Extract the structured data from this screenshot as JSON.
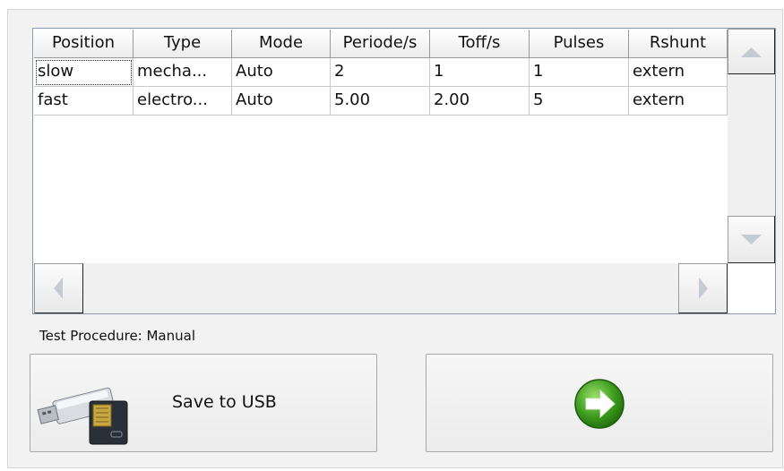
{
  "table": {
    "columns": [
      "Position",
      "Type",
      "Mode",
      "Periode/s",
      "Toff/s",
      "Pulses",
      "Rshunt"
    ],
    "rows": [
      [
        "slow",
        "mecha...",
        "Auto",
        "2",
        "1",
        "1",
        "extern"
      ],
      [
        "fast",
        "electro...",
        "Auto",
        "5.00",
        "2.00",
        "5",
        "extern"
      ]
    ]
  },
  "scrollbars": {
    "up_icon": "arrow-up-icon",
    "down_icon": "arrow-down-icon",
    "left_icon": "arrow-left-icon",
    "right_icon": "arrow-right-icon"
  },
  "procedure": {
    "text": "Test Procedure: Manual"
  },
  "buttons": {
    "save": {
      "label": "Save to USB",
      "icon": "usb-drive-icon"
    },
    "next": {
      "icon": "next-arrow-icon"
    }
  },
  "colors": {
    "arrow_green": "#3c9a1e",
    "table_border": "#8a9bb0"
  }
}
